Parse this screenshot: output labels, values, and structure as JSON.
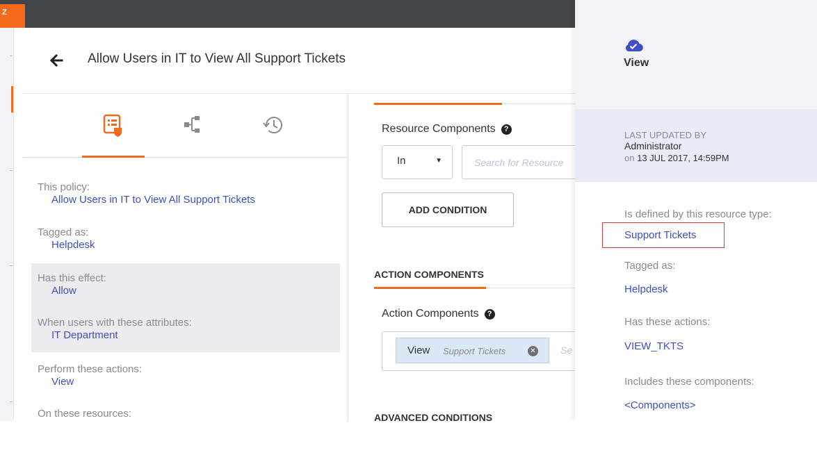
{
  "brand": {
    "label": "Z"
  },
  "header": {
    "title": "Allow Users in IT to View All Support Tickets"
  },
  "tabs": [
    {
      "name": "policy-summary",
      "icon": "policy-document-icon",
      "active": true
    },
    {
      "name": "hierarchy",
      "icon": "hierarchy-tree-icon",
      "active": false
    },
    {
      "name": "history",
      "icon": "history-clock-icon",
      "active": false
    }
  ],
  "summary": {
    "policy_label": "This  policy:",
    "policy_value": "Allow Users in IT to View All Support Tickets",
    "tagged_label": "Tagged as:",
    "tagged_value": "Helpdesk",
    "effect_label": "Has this effect:",
    "effect_value": "Allow",
    "attributes_label": "When users with these attributes:",
    "attributes_value": "IT Department",
    "actions_label": "Perform these actions:",
    "actions_value": "View",
    "resources_label": "On these resources:"
  },
  "editor": {
    "resource_components_label": "Resource Components",
    "operator_value": "In",
    "resource_search_placeholder": "Search for Resource",
    "add_condition_label": "ADD CONDITION",
    "action_components_title": "ACTION COMPONENTS",
    "action_components_label": "Action Components",
    "chip_label": "View",
    "chip_sublabel": "Support Tickets",
    "chip_search_placeholder": "Se",
    "advanced_conditions_title": "ADVANCED CONDITIONS"
  },
  "side_panel": {
    "title": "View",
    "icon": "cloud-check-icon",
    "last_updated_label": "LAST UPDATED BY",
    "last_updated_by": "Administrator",
    "last_updated_on_prefix": "on",
    "last_updated_on": "13 JUL 2017, 14:59PM",
    "resource_type_label": "Is defined by this resource type:",
    "resource_type_value": "Support Tickets",
    "tagged_label": "Tagged as:",
    "tagged_value": "Helpdesk",
    "actions_label": "Has these actions:",
    "actions_value": "VIEW_TKTS",
    "components_label": "Includes these components:",
    "components_value": "<Components>"
  },
  "colors": {
    "accent": "#f26a1b",
    "link": "#3f4fc3",
    "topbar": "#444548",
    "highlight": "#d23c3c"
  }
}
